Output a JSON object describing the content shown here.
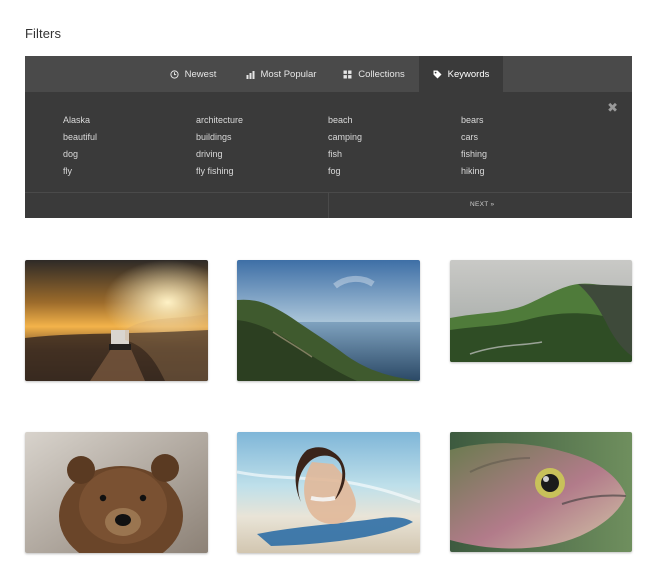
{
  "page": {
    "title": "Filters"
  },
  "tabs": [
    {
      "label": "Newest",
      "icon": "clock-icon"
    },
    {
      "label": "Most Popular",
      "icon": "bar-chart-icon"
    },
    {
      "label": "Collections",
      "icon": "grid-icon"
    },
    {
      "label": "Keywords",
      "icon": "tag-icon",
      "active": true
    }
  ],
  "keywords": {
    "col1": [
      "Alaska",
      "beautiful",
      "dog",
      "fly"
    ],
    "col2": [
      "architecture",
      "buildings",
      "driving",
      "fly fishing"
    ],
    "col3": [
      "beach",
      "camping",
      "fish",
      "fog"
    ],
    "col4": [
      "bears",
      "cars",
      "fishing",
      "hiking"
    ]
  },
  "pager": {
    "next_label": "NEXT »"
  },
  "close": {
    "glyph": "✖"
  },
  "gallery": {
    "items": [
      {
        "subject": "car on dirt road at sunset",
        "icon": "photo"
      },
      {
        "subject": "coastal cliffs and sea",
        "icon": "photo"
      },
      {
        "subject": "green mountain cliffs",
        "icon": "photo"
      },
      {
        "subject": "brown bear",
        "icon": "photo"
      },
      {
        "subject": "woman on surfboard at beach",
        "icon": "photo"
      },
      {
        "subject": "trout fish close-up",
        "icon": "photo"
      }
    ]
  },
  "colors": {
    "panel": "#3a3a3a",
    "tabbar": "#4a4a4a",
    "text_light": "#d9d9d9"
  }
}
